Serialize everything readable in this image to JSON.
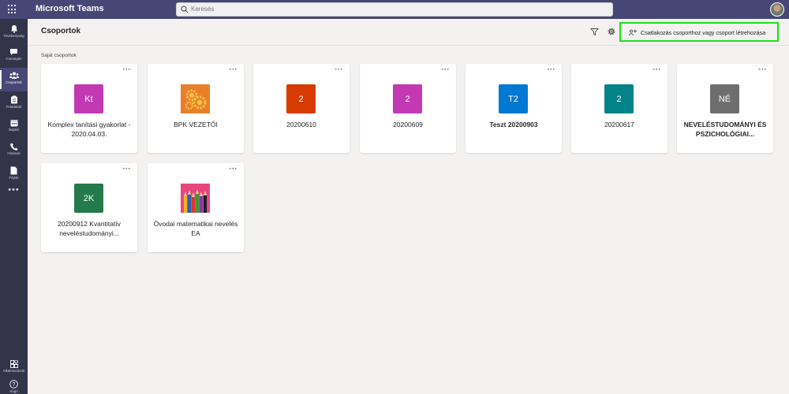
{
  "app": {
    "title": "Microsoft Teams"
  },
  "search": {
    "placeholder": "Keresés"
  },
  "rail": {
    "items": [
      {
        "label": "Tevékenység",
        "icon": "bell-icon"
      },
      {
        "label": "Csevegés",
        "icon": "chat-icon"
      },
      {
        "label": "Csoportok",
        "icon": "teams-icon",
        "active": true
      },
      {
        "label": "Feladatok",
        "icon": "assignments-icon"
      },
      {
        "label": "Naptár",
        "icon": "calendar-icon"
      },
      {
        "label": "Hívások",
        "icon": "phone-icon"
      },
      {
        "label": "Fájlok",
        "icon": "files-icon"
      }
    ],
    "more": "•••",
    "bottom": [
      {
        "label": "Alkalmazások",
        "icon": "apps-icon"
      },
      {
        "label": "Súgó",
        "icon": "help-icon"
      }
    ]
  },
  "header": {
    "title": "Csoportok",
    "join_button": "Csatlakozás csoporthoz vagy csoport létrehozása"
  },
  "section": {
    "label": "Saját csoportok"
  },
  "teams": [
    {
      "initials": "Kt",
      "color": "#c239b3",
      "name": "Komplex tanítási gyakorlat - 2020.04.03.",
      "bold": false,
      "image": null
    },
    {
      "initials": "",
      "color": "#e8802a",
      "name": "BPK VEZETŐI",
      "bold": false,
      "image": "gears"
    },
    {
      "initials": "2",
      "color": "#d83b01",
      "name": "20200610",
      "bold": false,
      "image": null
    },
    {
      "initials": "2",
      "color": "#c239b3",
      "name": "20200609",
      "bold": false,
      "image": null
    },
    {
      "initials": "T2",
      "color": "#0078d4",
      "name": "Teszt 20200903",
      "bold": true,
      "image": null
    },
    {
      "initials": "2",
      "color": "#038387",
      "name": "20200617",
      "bold": false,
      "image": null
    },
    {
      "initials": "NÉ",
      "color": "#6e6e6e",
      "name": "NEVELÉSTUDOMÁNYI ÉS PSZICHOLÓGIAI...",
      "bold": true,
      "image": null
    },
    {
      "initials": "2K",
      "color": "#237b4b",
      "name": "20200912 Kvantitatív neveléstudományi...",
      "bold": false,
      "image": null
    },
    {
      "initials": "",
      "color": "#e8457f",
      "name": "Óvodai matematikai nevelés EA",
      "bold": false,
      "image": "pencils"
    }
  ],
  "card_more": "···"
}
